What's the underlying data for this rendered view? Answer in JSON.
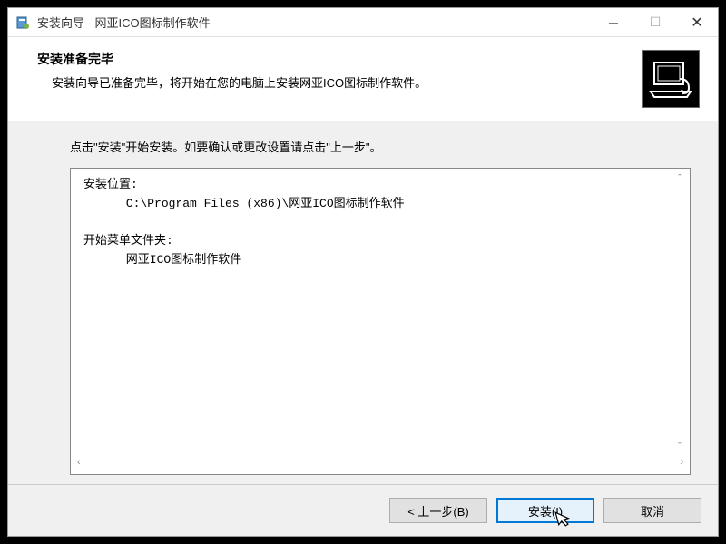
{
  "titlebar": {
    "title": "安装向导 - 网亚ICO图标制作软件"
  },
  "header": {
    "title": "安装准备完毕",
    "subtitle": "安装向导已准备完毕，将开始在您的电脑上安装网亚ICO图标制作软件。"
  },
  "content": {
    "instruction": "点击\"安装\"开始安装。如要确认或更改设置请点击\"上一步\"。",
    "summary": {
      "loc_label": "安装位置:",
      "loc_value": "      C:\\Program Files (x86)\\网亚ICO图标制作软件",
      "menu_label": "开始菜单文件夹:",
      "menu_value": "      网亚ICO图标制作软件"
    }
  },
  "footer": {
    "back": "< 上一步(B)",
    "install": "安装(I)",
    "cancel": "取消"
  }
}
